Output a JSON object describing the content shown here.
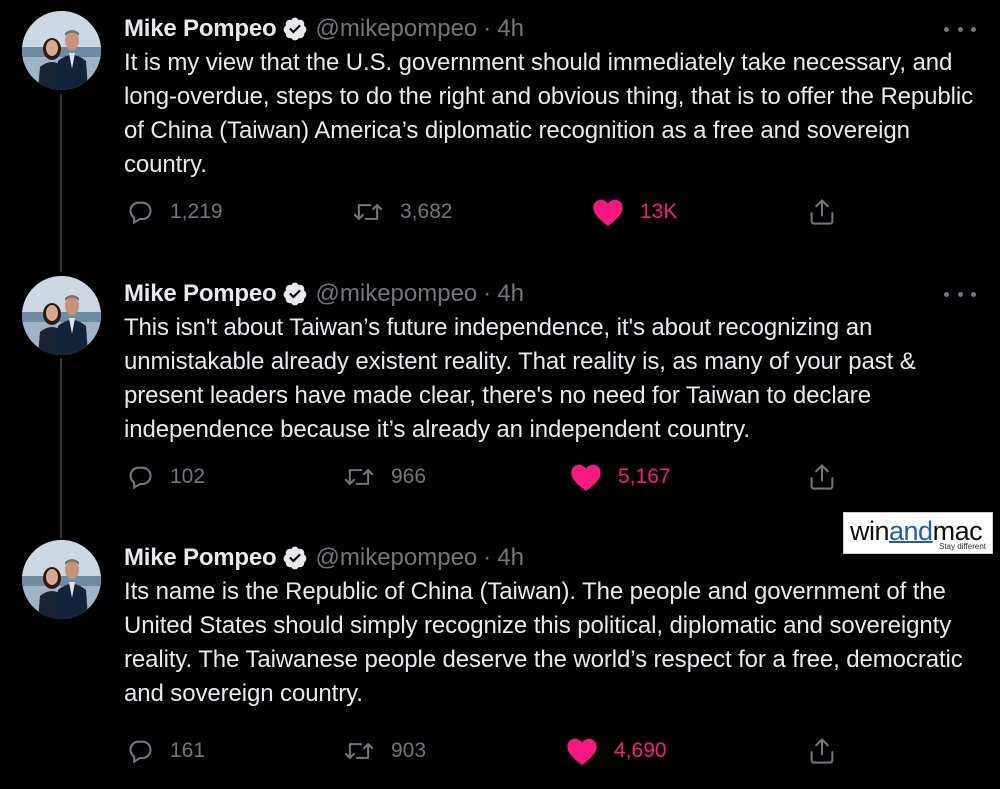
{
  "colors": {
    "background": "#000000",
    "text": "#e7e9ea",
    "muted": "#71767b",
    "like": "#f91880",
    "verified_fill": "#e7e9ea"
  },
  "tweets": [
    {
      "name": "Mike Pompeo",
      "handle": "@mikepompeo",
      "separator": "·",
      "time": "4h",
      "text": "It is my view that the U.S. government should immediately take necessary, and long-overdue, steps to do the right and obvious thing, that is to offer the Republic of China (Taiwan) America’s diplomatic recognition as a free and sovereign country.",
      "replies": "1,219",
      "retweets": "3,682",
      "likes": "13K",
      "liked": true
    },
    {
      "name": "Mike Pompeo",
      "handle": "@mikepompeo",
      "separator": "·",
      "time": "4h",
      "text": "This isn't about Taiwan’s future independence, it's about recognizing an unmistakable already existent reality. That reality is, as many of your past & present leaders have made clear, there's no need for Taiwan to declare independence because it’s already an independent country.",
      "replies": "102",
      "retweets": "966",
      "likes": "5,167",
      "liked": true
    },
    {
      "name": "Mike Pompeo",
      "handle": "@mikepompeo",
      "separator": "·",
      "time": "4h",
      "text": "Its name is the Republic of China (Taiwan).  The people and government of the United States should simply recognize this political, diplomatic and sovereignty reality.  The Taiwanese people deserve the world’s respect for a free, democratic and sovereign country.",
      "replies": "161",
      "retweets": "903",
      "likes": "4,690",
      "liked": true
    }
  ],
  "watermark": {
    "win": "win",
    "and": "and",
    "mac": "mac",
    "tagline": "Stay different"
  },
  "icons": {
    "reply": "reply-icon",
    "retweet": "retweet-icon",
    "like": "heart-icon",
    "share": "share-icon",
    "more": "more-options-icon",
    "verified": "verified-badge-icon"
  }
}
